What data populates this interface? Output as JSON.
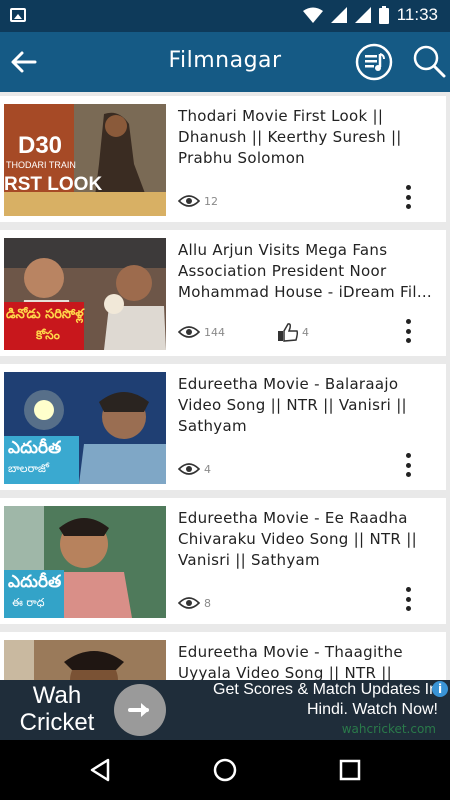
{
  "status_bar": {
    "time": "11:33"
  },
  "app_bar": {
    "title": "Filmnagar"
  },
  "videos": [
    {
      "title": "Thodari Movie First Look ||\nDhanush || Keerthy Suresh ||\nPrabhu Solomon",
      "views": "12",
      "thumb_text1": "D30",
      "thumb_text2": "THODARI TRAIN",
      "thumb_text3": "RST LOOK"
    },
    {
      "title": "Allu Arjun Visits Mega Fans\nAssociation President Noor\nMohammad House - iDream Fil…",
      "views": "144",
      "likes": "4",
      "thumb_text1": "డినోడు సరిసోళ్ల",
      "thumb_text2": "కోసం"
    },
    {
      "title": "Edureetha Movie - Balaraajo\nVideo Song || NTR || Vanisri ||\nSathyam",
      "views": "4",
      "thumb_text1": "ఎదురీత",
      "thumb_text2": "బాలరాజో"
    },
    {
      "title": "Edureetha Movie - Ee Raadha\nChivaraku Video Song || NTR ||\nVanisri || Sathyam",
      "views": "8",
      "thumb_text1": "ఎదురీత",
      "thumb_text2": "ఈ రాధ"
    },
    {
      "title": "Edureetha Movie - Thaagithe\nUyyala Video Song || NTR || Vanisri"
    }
  ],
  "ad": {
    "brand": "Wah\nCricket",
    "headline": "Get Scores & Match Updates In\nHindi. Watch Now!",
    "domain": "wahcricket.com",
    "info_glyph": "i"
  },
  "colors": {
    "status_bar": "#0e3a5a",
    "app_bar": "#155a85",
    "ad_bg": "#1f2d3a",
    "nav_bar": "#000000"
  }
}
